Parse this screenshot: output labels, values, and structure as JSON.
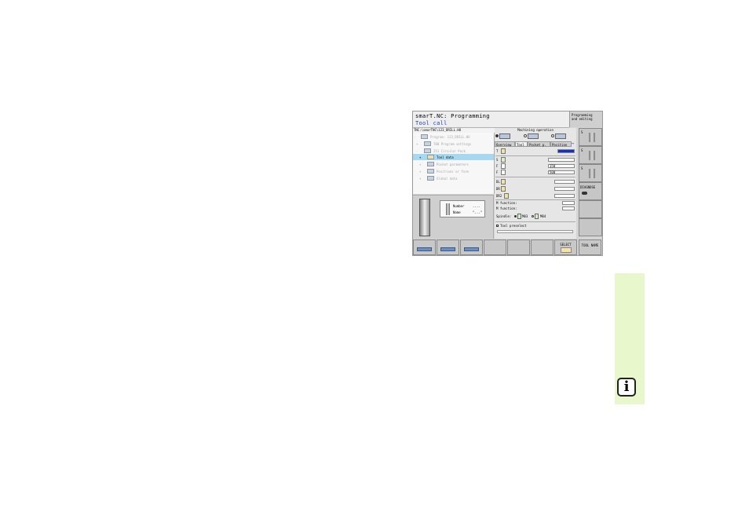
{
  "header": {
    "title": "smarT.NC: Programming",
    "subtitle": "Tool call",
    "mode_line1": "Programming",
    "mode_line2": "and editing"
  },
  "path": "TNC:\\smarTNC\\123_DRILL.HU",
  "tree": [
    {
      "marker": "-",
      "label": "Program: 123_DRILL.HU",
      "selected": false
    },
    {
      "marker": "+",
      "label": "700 Program settings",
      "selected": false
    },
    {
      "marker": "-",
      "label": "251 Circular Pock",
      "selected": false
    },
    {
      "marker": "+",
      "label": "Tool data",
      "selected": true
    },
    {
      "marker": "+",
      "label": "Pocket parameters",
      "selected": false
    },
    {
      "marker": "+",
      "label": "Positions or form",
      "selected": false
    },
    {
      "marker": "+",
      "label": "Global data",
      "selected": false
    }
  ],
  "preview": {
    "number_label": "Number",
    "number_value": "....",
    "name_label": "Name",
    "name_value": "\"...\""
  },
  "form": {
    "title": "Machining operation",
    "tabs": [
      "Overview",
      "Tool",
      "Pocket p.",
      "Position"
    ],
    "tab_arrow": "↔",
    "rows": {
      "t_label": "T",
      "s_label": "S",
      "f1_label": "F",
      "f1_value": "150",
      "f2_label": "F",
      "f2_value": "500",
      "dl_label": "DL",
      "dr_label": "DR",
      "dr2_label": "DR2",
      "m1_label": "M function:",
      "m2_label": "M function:",
      "spindle_label": "Spindle:",
      "m03": "M03",
      "m04": "M04",
      "preselect_label": "Tool preselect"
    }
  },
  "softkeys_right": [
    {
      "label": "S"
    },
    {
      "label": "S"
    },
    {
      "label": "S"
    },
    {
      "label": "DIAGNOSE"
    },
    {
      "label": ""
    },
    {
      "label": ""
    }
  ],
  "softkeys_bottom": [
    {
      "label": ""
    },
    {
      "label": ""
    },
    {
      "label": ""
    },
    {
      "label": ""
    },
    {
      "label": ""
    },
    {
      "label": ""
    },
    {
      "label": "SELECT"
    },
    {
      "label": "TOOL NAME"
    }
  ],
  "colors": {
    "title_blue": "#2040c0",
    "selection": "#a8d8f0",
    "side_green": "#e9f7cc"
  },
  "info_icon": "i"
}
